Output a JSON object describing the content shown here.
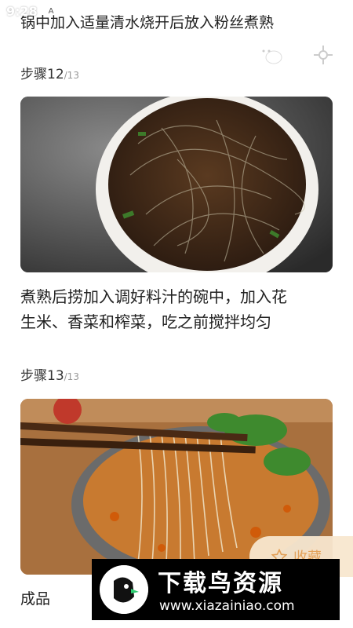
{
  "status_bar": {
    "time": "9:28"
  },
  "prev_caption": "锅中加入适量清水烧开后放入粉丝煮熟",
  "steps": [
    {
      "label": "步骤12",
      "total": "/13",
      "description_lines": [
        "煮熟后捞加入调好料汁的碗中，加入花",
        "生米、香菜和榨菜，吃之前搅拌均匀"
      ]
    },
    {
      "label": "步骤13",
      "total": "/13"
    }
  ],
  "final_label": "成品",
  "favorite": {
    "label": "收藏"
  },
  "watermark": {
    "title": "下载鸟资源",
    "url": "www.xiazainiao.com"
  },
  "colors": {
    "accent": "#e8a45a",
    "fav_bg": "#f8e7cf"
  }
}
